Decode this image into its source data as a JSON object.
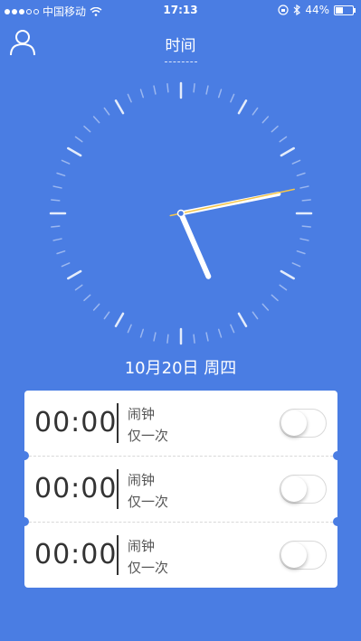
{
  "status_bar": {
    "carrier": "中国移动",
    "time": "17:13",
    "battery": "44%",
    "icons": [
      "signal-dots",
      "wifi-icon",
      "orientation-lock-icon",
      "bluetooth-icon",
      "battery-icon"
    ]
  },
  "nav": {
    "title": "时间",
    "user_icon": "user-icon"
  },
  "clock": {
    "hour": 5,
    "minute": 13,
    "second": 7,
    "colors": {
      "hands": "#ffffff",
      "second_hand": "#f5c64c",
      "ticks": "#ffffff"
    }
  },
  "date": {
    "text": "10月20日  周四"
  },
  "alarms": [
    {
      "time": "00:00",
      "label": "闹钟",
      "repeat": "仅一次",
      "enabled": false
    },
    {
      "time": "00:00",
      "label": "闹钟",
      "repeat": "仅一次",
      "enabled": false
    },
    {
      "time": "00:00",
      "label": "闹钟",
      "repeat": "仅一次",
      "enabled": false
    }
  ],
  "colors": {
    "background": "#4a7de3",
    "card": "#ffffff"
  }
}
